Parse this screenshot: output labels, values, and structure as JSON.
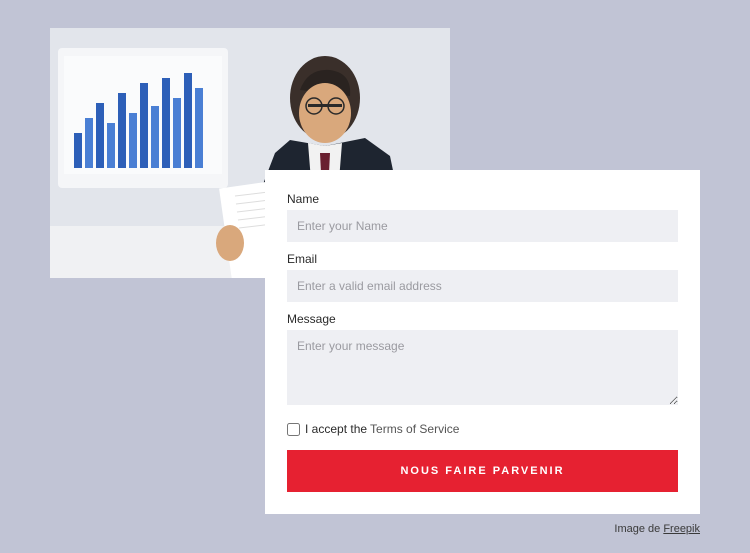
{
  "form": {
    "fields": {
      "name": {
        "label": "Name",
        "placeholder": "Enter your Name"
      },
      "email": {
        "label": "Email",
        "placeholder": "Enter a valid email address"
      },
      "message": {
        "label": "Message",
        "placeholder": "Enter your message"
      }
    },
    "consent": {
      "prefix": "I accept the",
      "link_text": "Terms of Service"
    },
    "submit_label": "NOUS FAIRE PARVENIR"
  },
  "credit": {
    "prefix": "Image de ",
    "link_text": "Freepik"
  }
}
